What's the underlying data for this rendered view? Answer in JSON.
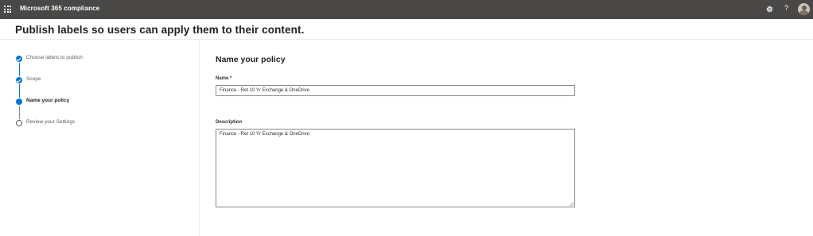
{
  "app": {
    "title": "Microsoft 365 compliance",
    "icons": {
      "launcher": "waffle-icon",
      "settings": "gear-icon",
      "help": "help-icon",
      "profile": "avatar"
    },
    "help_glyph": "?"
  },
  "page": {
    "title": "Publish labels so users can apply them to their content."
  },
  "wizard": {
    "steps": [
      {
        "label": "Choose labels to publish",
        "state": "completed"
      },
      {
        "label": "Scope",
        "state": "completed"
      },
      {
        "label": "Name your policy",
        "state": "current"
      },
      {
        "label": "Review your Settings",
        "state": "pending"
      }
    ]
  },
  "form": {
    "section_title": "Name your policy",
    "name": {
      "label": "Name *",
      "value": "Finance - Ret 10 Yr Exchange & OneDrive"
    },
    "description": {
      "label": "Description",
      "value": "Finance - Ret 10 Yr Exchange & OneDrive"
    }
  },
  "colors": {
    "top_bar": "#4a4846",
    "accent": "#0078d4",
    "border": "#8a8886",
    "divider": "#edebe9"
  }
}
